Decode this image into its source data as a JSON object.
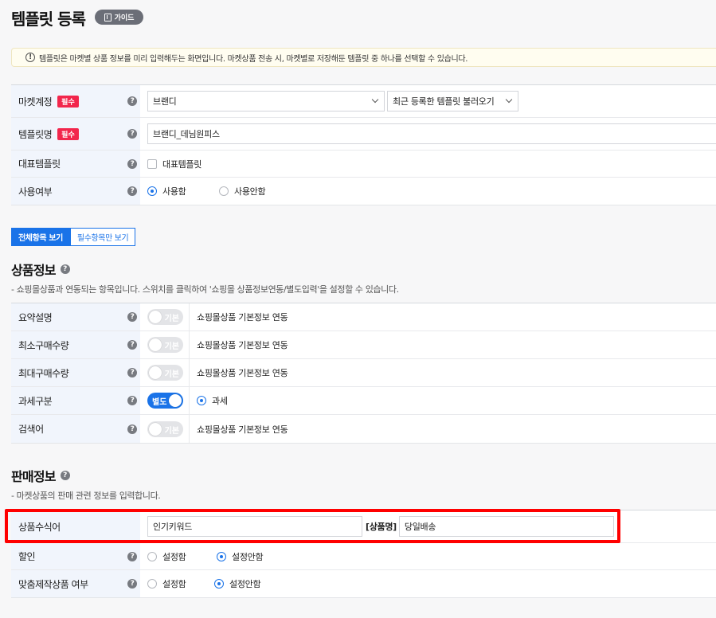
{
  "page": {
    "title": "템플릿 등록",
    "guide_label": "가이드",
    "notice": "템플릿은 마켓별 상품 정보를 미리 입력해두는 화면입니다. 마켓상품 전송 시, 마켓별로 저장해둔 템플릿 중 하나를 선택할 수 있습니다."
  },
  "basic": {
    "market_account": {
      "label": "마켓계정",
      "required": "필수",
      "value": "브랜디",
      "load_label": "최근 등록한 템플릿 불러오기"
    },
    "template_name": {
      "label": "템플릿명",
      "required": "필수",
      "value": "브랜디_데님원피스"
    },
    "default_template": {
      "label": "대표템플릿",
      "checkbox_label": "대표템플릿"
    },
    "usage": {
      "label": "사용여부",
      "options": [
        "사용함",
        "사용안함"
      ],
      "selected": "사용함"
    }
  },
  "view_tabs": {
    "all": "전체항목 보기",
    "required_only": "필수항목만 보기"
  },
  "product_info": {
    "title": "상품정보",
    "desc": "- 쇼핑몰상품과 연동되는 항목입니다. 스위치를 클릭하여 '쇼핑몰 상품정보연동/별도입력'을 설정할 수 있습니다.",
    "rows": [
      {
        "label": "요약설명",
        "toggle": "기본",
        "on": false,
        "value": "쇼핑몰상품 기본정보 연동"
      },
      {
        "label": "최소구매수량",
        "toggle": "기본",
        "on": false,
        "value": "쇼핑몰상품 기본정보 연동"
      },
      {
        "label": "최대구매수량",
        "toggle": "기본",
        "on": false,
        "value": "쇼핑몰상품 기본정보 연동"
      },
      {
        "label": "과세구분",
        "toggle": "별도",
        "on": true,
        "value": "과세"
      },
      {
        "label": "검색어",
        "toggle": "기본",
        "on": false,
        "value": "쇼핑몰상품 기본정보 연동"
      }
    ]
  },
  "sales_info": {
    "title": "판매정보",
    "desc": "- 마켓상품의 판매 관련 정보를 입력합니다.",
    "modifier": {
      "label": "상품수식어",
      "value1": "인기키워드",
      "tag": "[상품명]",
      "value2": "당일배송"
    },
    "discount": {
      "label": "할인",
      "options": [
        "설정함",
        "설정안함"
      ],
      "selected": "설정안함"
    },
    "custom_made": {
      "label": "맞춤제작상품 여부",
      "options": [
        "설정함",
        "설정안함"
      ],
      "selected": "설정안함"
    }
  },
  "colors": {
    "accent": "#1a73e8",
    "required_badge": "#f2264c",
    "highlight": "#ff0000"
  }
}
